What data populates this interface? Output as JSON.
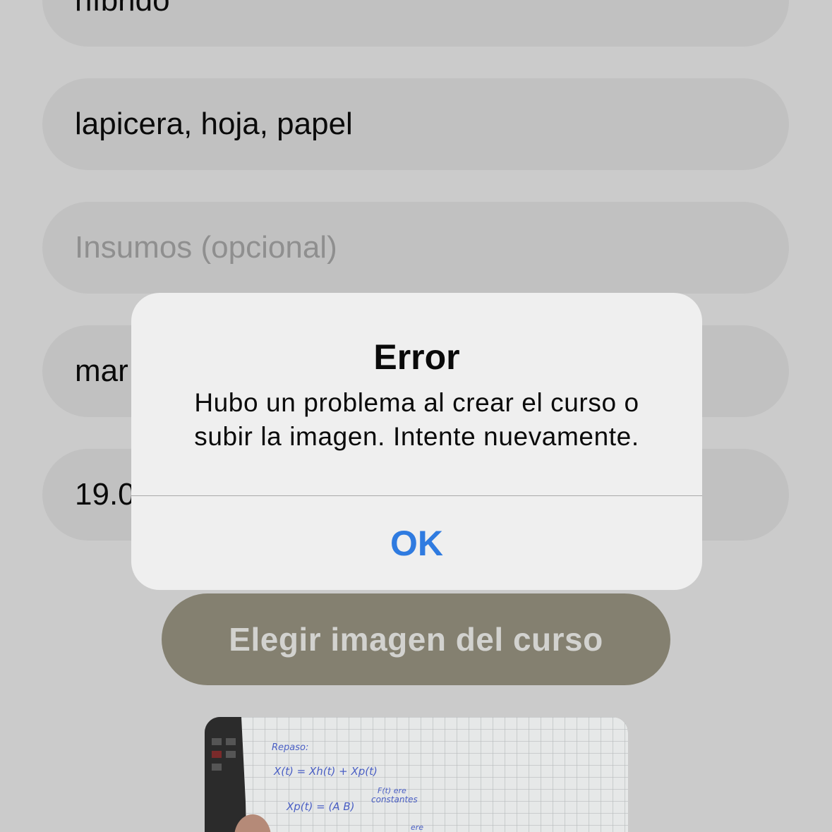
{
  "form": {
    "mode_value": "híbrido",
    "materials_value": "lapicera, hoja, papel",
    "supplies_placeholder": "Insumos (opcional)",
    "schedule_value_partial": "mar",
    "price_value_partial": "19.0",
    "choose_image_label": "Elegir imagen del curso"
  },
  "preview": {
    "handwriting": {
      "line1": "Repaso:",
      "line2": "X(t) = Xh(t) + Xp(t)",
      "line3": "F(t) ere",
      "line4": "constantes",
      "line5": "Xp(t) = (A B)",
      "line6": "ere"
    }
  },
  "alert": {
    "title": "Error",
    "message": "Hubo un problema al crear el curso o subir la imagen. Intente nuevamente.",
    "ok_label": "OK"
  },
  "colors": {
    "background": "#cbcbcb",
    "field": "#c1c1c1",
    "button": "#848070",
    "alert": "#efefef",
    "accent": "#2f7be0"
  }
}
